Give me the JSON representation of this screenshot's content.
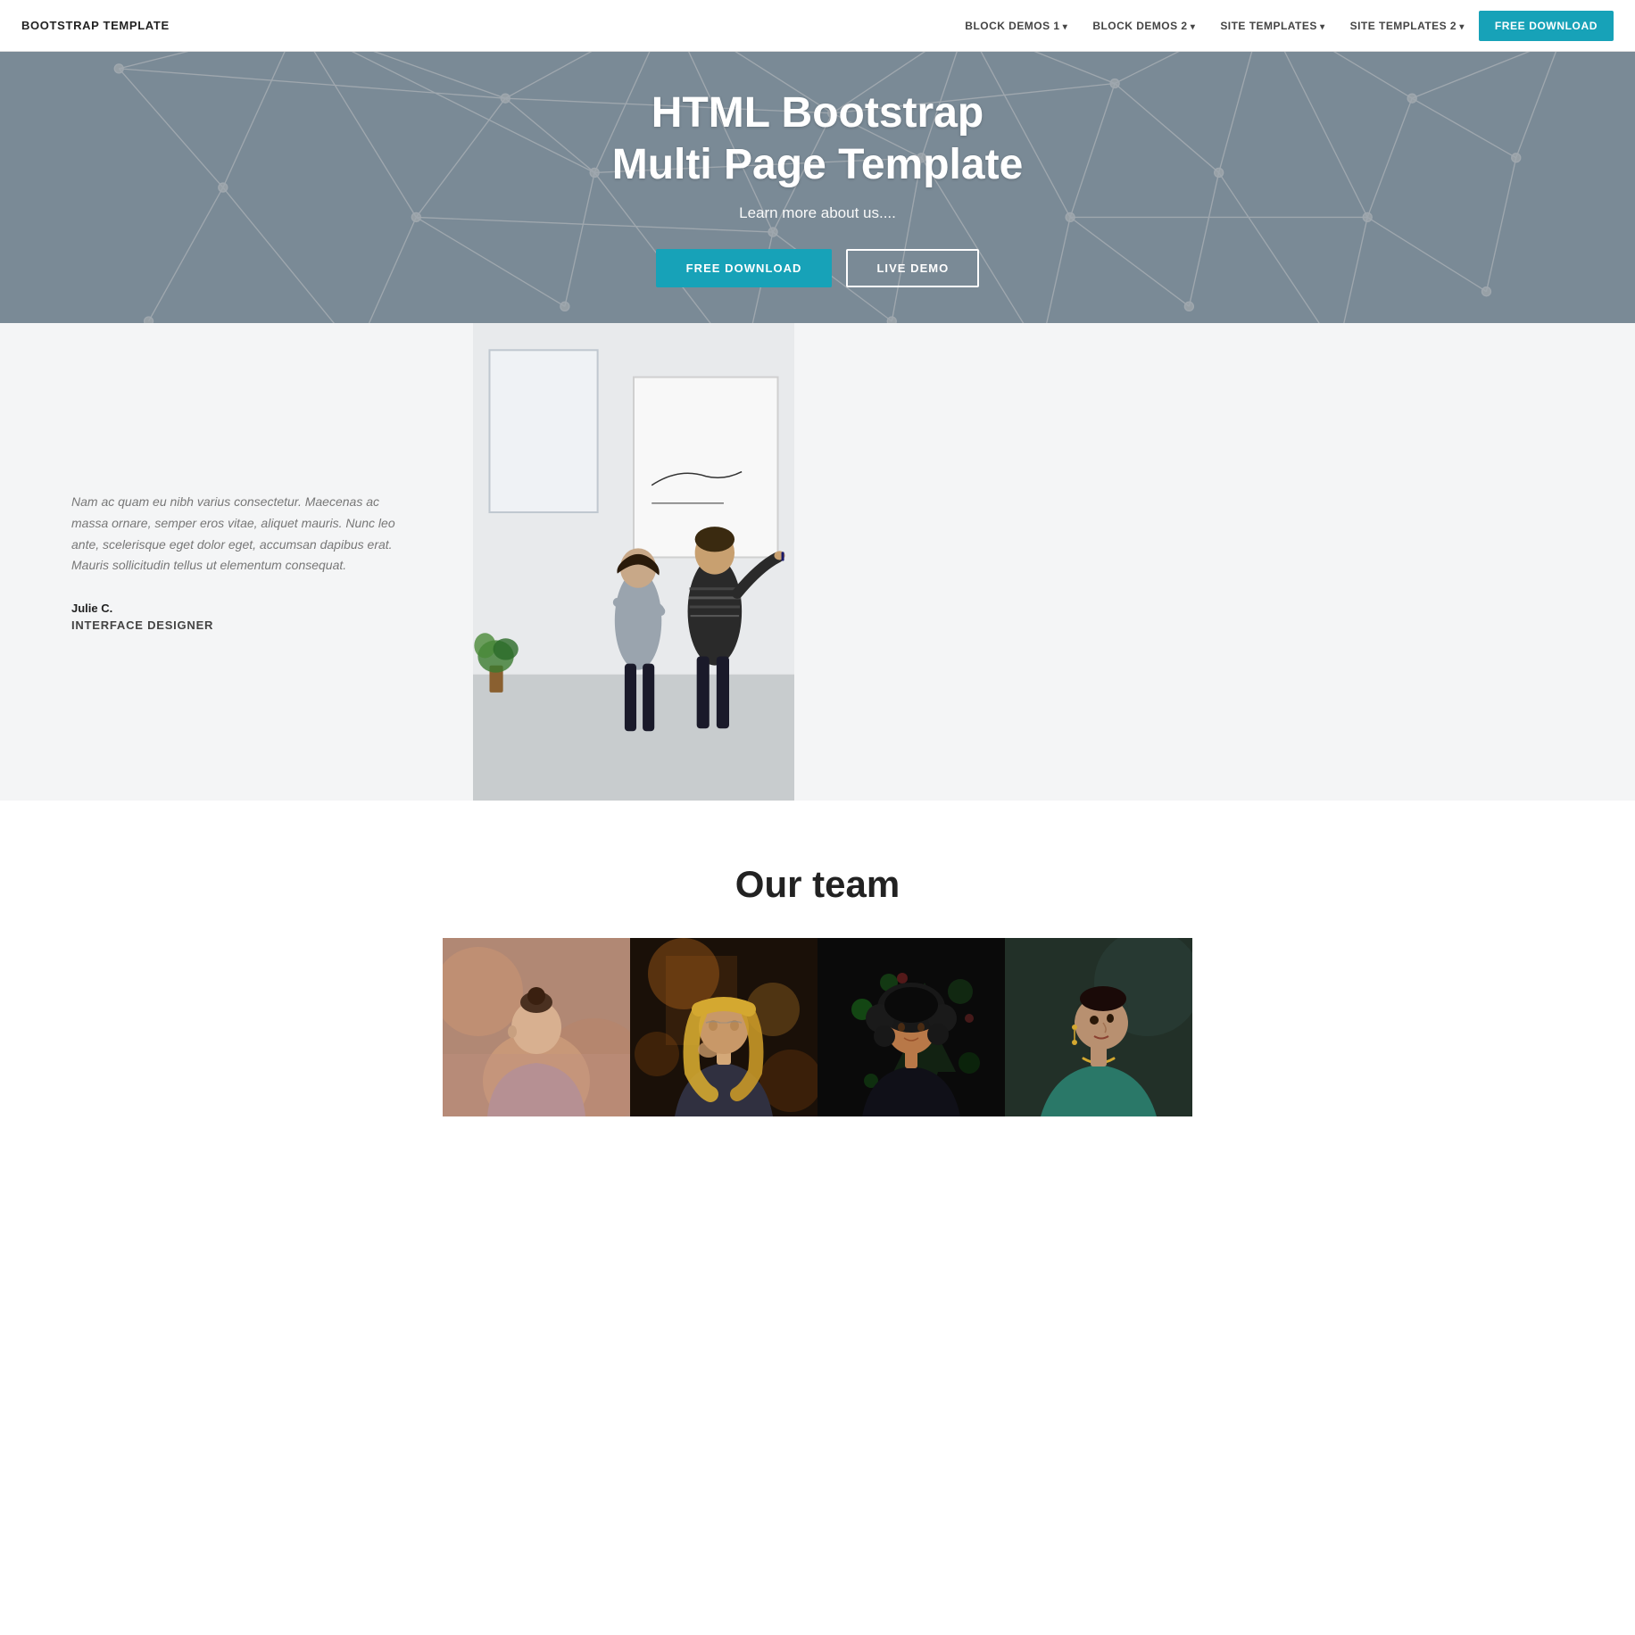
{
  "navbar": {
    "brand": "BOOTSTRAP TEMPLATE",
    "links": [
      {
        "label": "BLOCK DEMOS 1",
        "dropdown": true
      },
      {
        "label": "BLOCK DEMOS 2",
        "dropdown": true
      },
      {
        "label": "SITE TEMPLATES",
        "dropdown": true
      },
      {
        "label": "SITE TEMPLATES 2",
        "dropdown": true
      }
    ],
    "cta_label": "FREE DOWNLOAD"
  },
  "hero": {
    "title_line1": "HTML Bootstrap",
    "title_line2": "Multi Page Template",
    "subtitle": "Learn more about us....",
    "btn_download": "FREE DOWNLOAD",
    "btn_demo": "LIVE DEMO"
  },
  "feature": {
    "quote": "Nam ac quam eu nibh varius consectetur. Maecenas ac massa ornare, semper eros vitae, aliquet mauris. Nunc leo ante, scelerisque eget dolor eget, accumsan dapibus erat. Mauris sollicitudin tellus ut elementum consequat.",
    "name": "Julie C.",
    "role": "INTERFACE DESIGNER"
  },
  "team": {
    "title": "Our team",
    "members": [
      {
        "id": 1,
        "alt": "Team member 1 - woman with bun"
      },
      {
        "id": 2,
        "alt": "Team member 2 - woman with glasses"
      },
      {
        "id": 3,
        "alt": "Team member 3 - woman with curly hair"
      },
      {
        "id": 4,
        "alt": "Team member 4 - woman with necklace"
      }
    ]
  },
  "colors": {
    "accent": "#17a2b8",
    "hero_bg": "#7a8a96",
    "feature_bg": "#f4f5f6"
  }
}
